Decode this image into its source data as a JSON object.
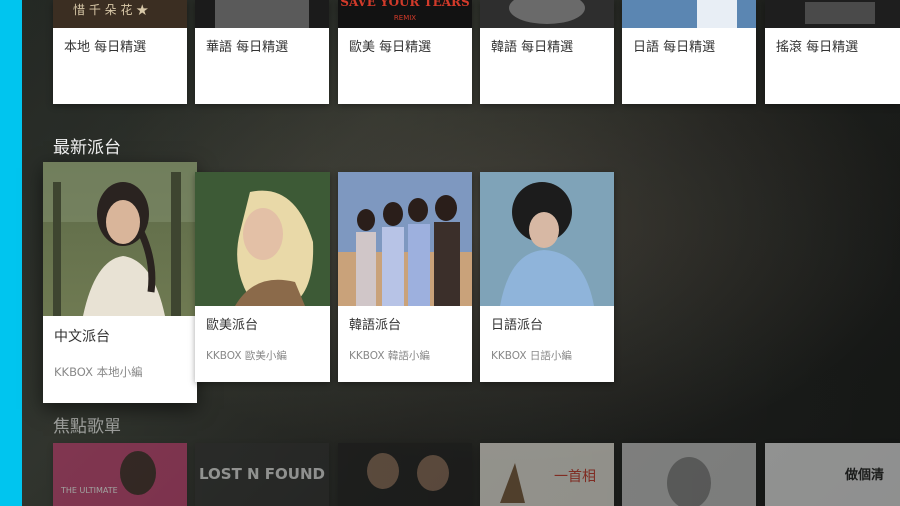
{
  "daily_picks": [
    {
      "title": "本地 每日精選",
      "art_text": "惜 千 朵 花 ★"
    },
    {
      "title": "華語 每日精選",
      "art_text": ""
    },
    {
      "title": "歐美 每日精選",
      "art_text": "SAVE YOUR TEARS",
      "art_sub": "REMIX"
    },
    {
      "title": "韓語 每日精選",
      "art_text": ""
    },
    {
      "title": "日語 每日精選",
      "art_text": ""
    },
    {
      "title": "搖滾 每日精選",
      "art_text": ""
    }
  ],
  "stations": {
    "heading": "最新派台",
    "items": [
      {
        "title": "中文派台",
        "subtitle": "KKBOX 本地小編"
      },
      {
        "title": "歐美派台",
        "subtitle": "KKBOX 歐美小編"
      },
      {
        "title": "韓語派台",
        "subtitle": "KKBOX 韓語小編"
      },
      {
        "title": "日語派台",
        "subtitle": "KKBOX 日語小編"
      }
    ]
  },
  "featured": {
    "heading": "焦點歌單",
    "items": [
      {
        "art_text": "THE ULTIMATE"
      },
      {
        "art_text": "LOST N FOUND"
      },
      {
        "art_text": ""
      },
      {
        "art_text": "一首相"
      },
      {
        "art_text": ""
      },
      {
        "art_text": "做個清"
      }
    ]
  },
  "colors": {
    "accent": "#00c5ef"
  }
}
